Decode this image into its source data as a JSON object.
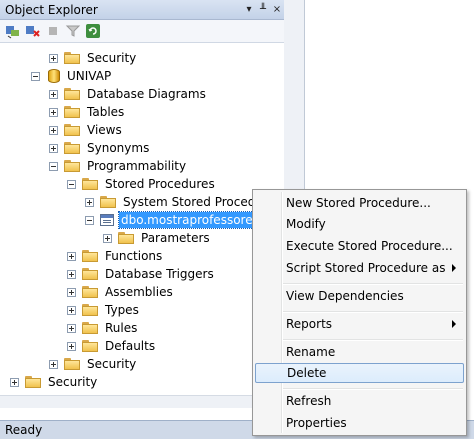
{
  "explorer": {
    "title": "Object Explorer",
    "title_controls": [
      "▾",
      "╨",
      "×"
    ]
  },
  "tree": [
    {
      "label": "Security",
      "expander": "plus",
      "icon": "folder"
    },
    {
      "label": "UNIVAP",
      "expander": "minus",
      "icon": "database"
    },
    {
      "label": "Database Diagrams",
      "expander": "plus",
      "icon": "folder"
    },
    {
      "label": "Tables",
      "expander": "plus",
      "icon": "folder"
    },
    {
      "label": "Views",
      "expander": "plus",
      "icon": "folder"
    },
    {
      "label": "Synonyms",
      "expander": "plus",
      "icon": "folder"
    },
    {
      "label": "Programmability",
      "expander": "minus",
      "icon": "folder"
    },
    {
      "label": "Stored Procedures",
      "expander": "minus",
      "icon": "folder"
    },
    {
      "label": "System Stored Procedures",
      "expander": "plus",
      "icon": "folder"
    },
    {
      "label": "dbo.mostraprofessores",
      "expander": "minus",
      "icon": "stored-procedure",
      "selected": true
    },
    {
      "label": "Parameters",
      "expander": "plus",
      "icon": "folder"
    },
    {
      "label": "Functions",
      "expander": "plus",
      "icon": "folder"
    },
    {
      "label": "Database Triggers",
      "expander": "plus",
      "icon": "folder"
    },
    {
      "label": "Assemblies",
      "expander": "plus",
      "icon": "folder"
    },
    {
      "label": "Types",
      "expander": "plus",
      "icon": "folder"
    },
    {
      "label": "Rules",
      "expander": "plus",
      "icon": "folder"
    },
    {
      "label": "Defaults",
      "expander": "plus",
      "icon": "folder"
    },
    {
      "label": "Security",
      "expander": "plus",
      "icon": "folder"
    },
    {
      "label": "Security",
      "expander": "plus",
      "icon": "folder"
    }
  ],
  "context_menu": {
    "items": [
      {
        "label": "New Stored Procedure..."
      },
      {
        "label": "Modify"
      },
      {
        "label": "Execute Stored Procedure..."
      },
      {
        "label": "Script Stored Procedure as",
        "submenu": true
      },
      {
        "label": "View Dependencies"
      },
      {
        "label": "Reports",
        "submenu": true
      },
      {
        "label": "Rename"
      },
      {
        "label": "Delete",
        "highlighted": true
      },
      {
        "label": "Refresh"
      },
      {
        "label": "Properties"
      }
    ]
  },
  "status": {
    "text": "Ready"
  },
  "colors": {
    "selection": "#3399ff",
    "menu_highlight_border": "#7da2ce",
    "title_bar": "#c3d2e8"
  }
}
